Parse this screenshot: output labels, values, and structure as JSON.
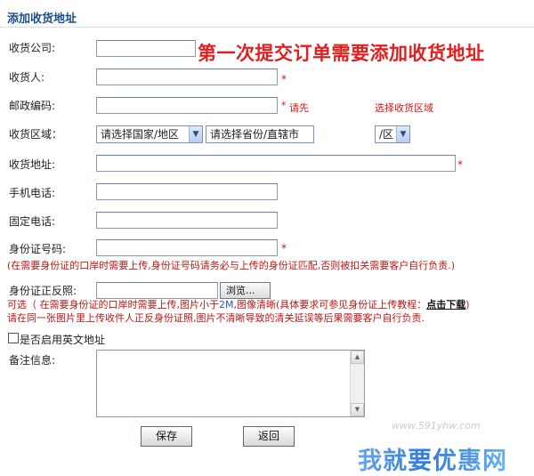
{
  "page": {
    "title": "添加收货地址"
  },
  "banner": {
    "text": "第一次提交订单需要添加收货地址"
  },
  "form": {
    "company": {
      "label": "收货公司:",
      "value": ""
    },
    "recipient": {
      "label": "收货人:",
      "value": "",
      "required": "*"
    },
    "postcode": {
      "label": "邮政编码:",
      "value": "",
      "required": "*",
      "hint_left": "请先",
      "hint_right": "选择收货区域"
    },
    "region": {
      "label": "收货区域：",
      "country": "请选择国家/地区",
      "province": "请选择省份/直辖市",
      "district": "/区"
    },
    "address": {
      "label": "收货地址:",
      "value": "",
      "required": "*"
    },
    "mobile": {
      "label": "手机电话:",
      "value": ""
    },
    "phone": {
      "label": "固定电话:",
      "value": ""
    },
    "id_number": {
      "label": "身份证号码:",
      "value": "",
      "required": "*",
      "warning": "(在需要身份证的口岸时需要上传,身份证号码请务必与上传的身份证匹配,否则被扣关需要客户自行负责.)"
    },
    "id_photo": {
      "label": "身份证正反照:",
      "browse": "浏览...",
      "tip_line1_a": "可选（ 在需要身份证的口岸时需要上传,图片小于",
      "tip_line1_size": "2M",
      "tip_line1_b": ",图像清晰(具体要求可参见身份证上传教程：",
      "tip_line1_link": "点击下载",
      "tip_line1_c": ")",
      "tip_line2": "请在同一张图片里上传收件人正反身份证照,图片不清晰导致的清关延误等后果需要客户自行负责."
    },
    "english": {
      "label": "是否启用英文地址",
      "checked": false
    },
    "notes": {
      "label": "备注信息:",
      "value": ""
    }
  },
  "buttons": {
    "save": "保存",
    "back": "返回"
  },
  "watermark": {
    "url": "www.591yhw.com",
    "text": "我就要优惠网"
  }
}
